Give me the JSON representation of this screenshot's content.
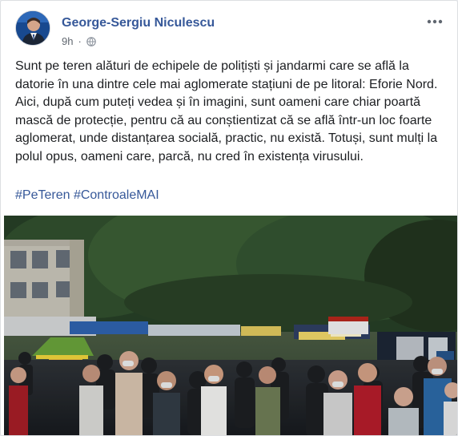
{
  "post": {
    "author": "George-Sergiu Niculescu",
    "time": "9h",
    "body": "Sunt pe teren alături de echipele de polițiști și jandarmi care se află la datorie în una dintre cele mai aglomerate stațiuni de pe litoral: Eforie Nord. Aici, după cum puteți vedea și în imagini, sunt oameni care chiar poartă mască de protecție, pentru că au conștientizat că se află într-un loc foarte aglomerat, unde distanțarea socială, practic, nu există. Totuși, sunt mulți la polul opus, oameni care, parcă, nu cred în existența virusului.",
    "hashtags": [
      "#PeTeren",
      "#ControaleMAI"
    ]
  },
  "icons": {
    "audience": "globe-icon",
    "menu": "more-options-icon"
  },
  "colors": {
    "link": "#365899",
    "text": "#1c1e21",
    "meta": "#616770",
    "card_border": "#dddfe2"
  }
}
